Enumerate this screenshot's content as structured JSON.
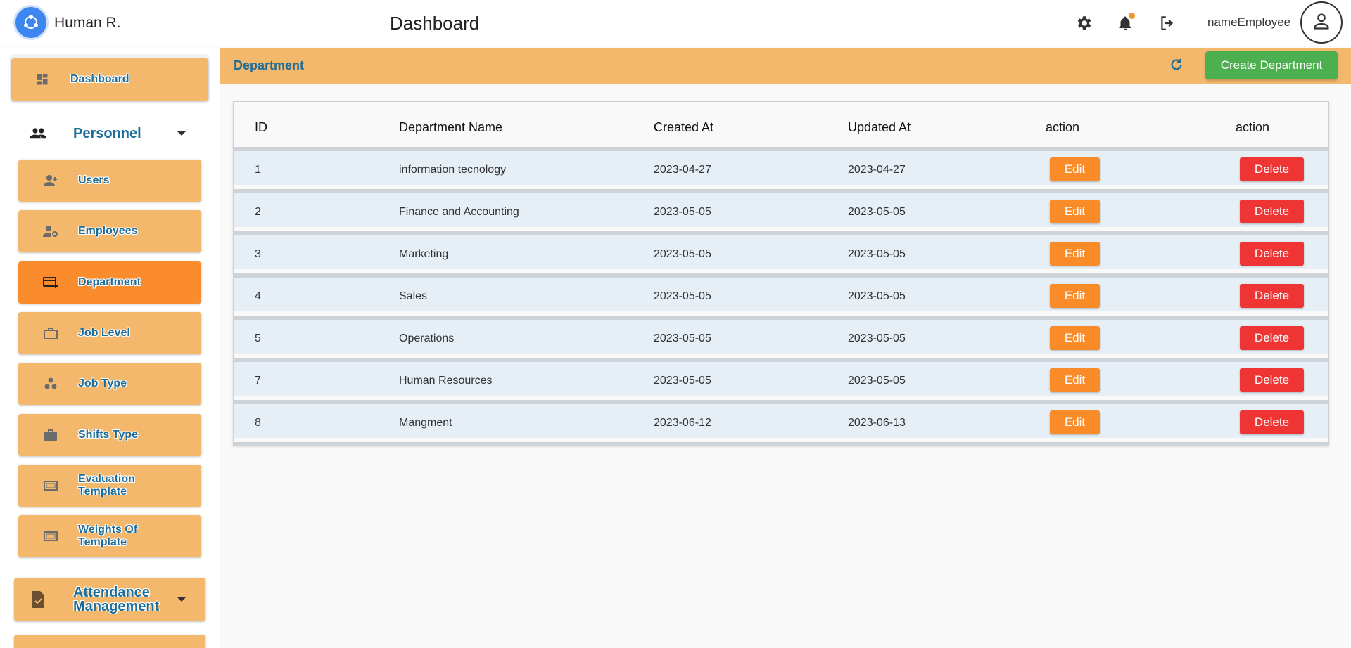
{
  "app": {
    "title": "Human R.",
    "page_title": "Dashboard"
  },
  "topbar": {
    "user_name": "nameEmployee",
    "icons": [
      "gear-icon",
      "bell-icon",
      "logout-icon",
      "user-icon"
    ],
    "notification_color": "#f5922f"
  },
  "sidebar": {
    "dashboard": "Dashboard",
    "personnel": {
      "label": "Personnel",
      "items": [
        {
          "label": "Users",
          "icon": "add-user-icon"
        },
        {
          "label": "Employees",
          "icon": "manage-accounts-icon"
        },
        {
          "label": "Department",
          "icon": "card-add-icon",
          "active": true
        },
        {
          "label": "Job Level",
          "icon": "briefcase-outline-icon"
        },
        {
          "label": "Job Type",
          "icon": "workspaces-icon"
        },
        {
          "label": "Shifts Type",
          "icon": "briefcase-icon"
        },
        {
          "label": "Evaluation Template",
          "icon": "frame-icon"
        },
        {
          "label": "Weights Of Template",
          "icon": "frame-icon"
        }
      ]
    },
    "attendance": {
      "label": "Attendance Management"
    }
  },
  "main": {
    "header_title": "Department",
    "create_button": "Create Department",
    "table": {
      "columns": [
        "ID",
        "Department Name",
        "Created At",
        "Updated At",
        "action",
        "action"
      ],
      "rows": [
        {
          "id": "1",
          "name": "information tecnology",
          "created": "2023-04-27",
          "updated": "2023-04-27",
          "edit": "Edit",
          "delete": "Delete"
        },
        {
          "id": "2",
          "name": "Finance and Accounting",
          "created": "2023-05-05",
          "updated": "2023-05-05",
          "edit": "Edit",
          "delete": "Delete"
        },
        {
          "id": "3",
          "name": "Marketing",
          "created": "2023-05-05",
          "updated": "2023-05-05",
          "edit": "Edit",
          "delete": "Delete"
        },
        {
          "id": "4",
          "name": "Sales",
          "created": "2023-05-05",
          "updated": "2023-05-05",
          "edit": "Edit",
          "delete": "Delete"
        },
        {
          "id": "5",
          "name": "Operations",
          "created": "2023-05-05",
          "updated": "2023-05-05",
          "edit": "Edit",
          "delete": "Delete"
        },
        {
          "id": "7",
          "name": "Human Resources",
          "created": "2023-05-05",
          "updated": "2023-05-05",
          "edit": "Edit",
          "delete": "Delete"
        },
        {
          "id": "8",
          "name": "Mangment",
          "created": "2023-06-12",
          "updated": "2023-06-13",
          "edit": "Edit",
          "delete": "Delete"
        }
      ]
    }
  },
  "colors": {
    "accent": "#f4b86c",
    "active": "#fa8c2e",
    "link_text": "#1d6d9a",
    "create": "#4caf50",
    "edit": "#f98c28",
    "delete": "#ef3434"
  }
}
